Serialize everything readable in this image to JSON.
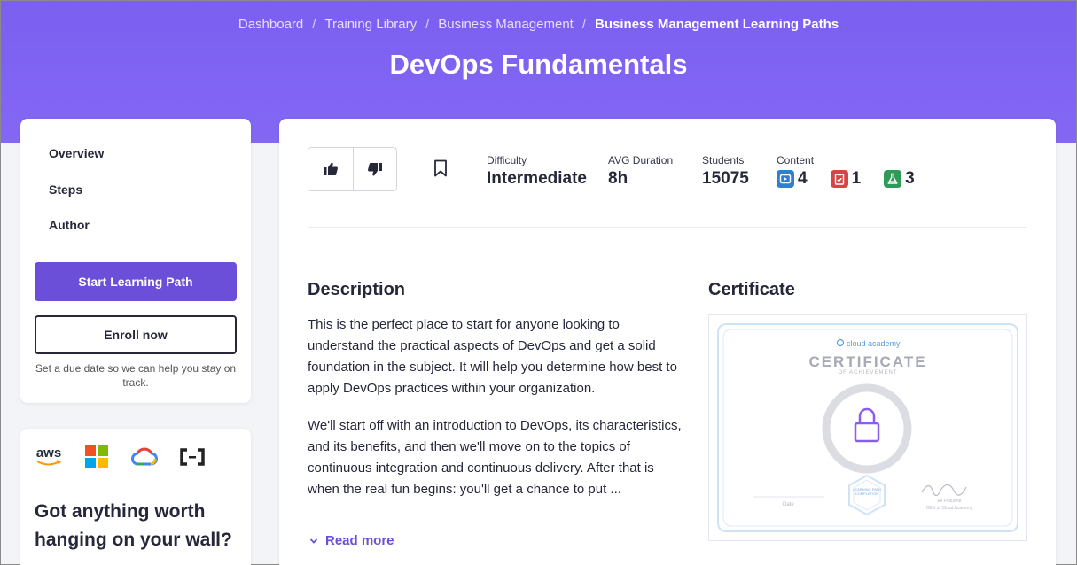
{
  "breadcrumb": {
    "items": [
      "Dashboard",
      "Training Library",
      "Business Management"
    ],
    "current": "Business Management Learning Paths",
    "separator": "/"
  },
  "page_title": "DevOps Fundamentals",
  "nav": {
    "items": [
      "Overview",
      "Steps",
      "Author"
    ],
    "start_button": "Start Learning Path",
    "enroll_button": "Enroll now",
    "due_note": "Set a due date so we can help you stay on track."
  },
  "partners": {
    "logos": [
      "aws-logo",
      "microsoft-logo",
      "google-cloud-logo",
      "alibaba-cloud-logo"
    ],
    "aws_text": "aws",
    "wall_title": "Got anything worth hanging on your wall?"
  },
  "stats": {
    "difficulty_label": "Difficulty",
    "difficulty_value": "Intermediate",
    "duration_label": "AVG Duration",
    "duration_value": "8h",
    "students_label": "Students",
    "students_value": "15075",
    "content_label": "Content",
    "content_items": [
      {
        "icon": "video-icon",
        "count": "4",
        "color": "#2f7fd1"
      },
      {
        "icon": "quiz-icon",
        "count": "1",
        "color": "#d64545"
      },
      {
        "icon": "lab-icon",
        "count": "3",
        "color": "#2e9b57"
      }
    ]
  },
  "description": {
    "title": "Description",
    "para1": "This is the perfect place to start for anyone looking to understand the practical aspects of DevOps and get a solid foundation in the subject. It will help you determine how best to apply DevOps practices within your organization.",
    "para2": "We'll start off with an introduction to DevOps, its characteristics, and its benefits, and then we'll move on to the topics of continuous integration and continuous delivery. After that is when the real fun begins: you'll get a chance to put ...",
    "read_more": "Read more"
  },
  "certificate": {
    "title": "Certificate",
    "brand": "cloud academy",
    "heading": "CERTIFICATE",
    "subheading": "OF ACHIEVEMENT",
    "date_label": "Date",
    "badge_text": "LEARNING PATH COMPLETION",
    "signer": "Eli Fhaurme",
    "signer_title": "CEO at Cloud Academy"
  },
  "colors": {
    "accent": "#6c4fd8",
    "hero": "#7b5ff0"
  }
}
